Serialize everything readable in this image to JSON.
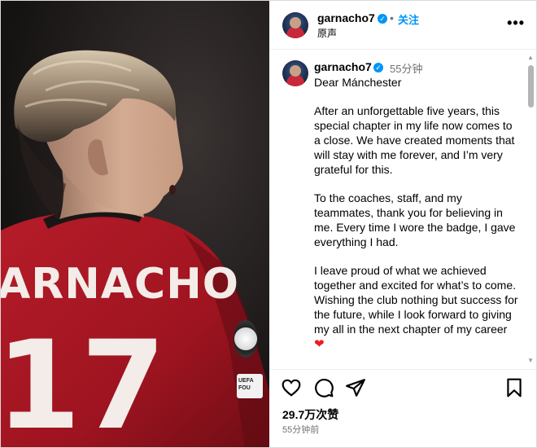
{
  "header": {
    "username": "garnacho7",
    "separator": "•",
    "follow_label": "关注",
    "audio_label": "原声",
    "more_label": "•••"
  },
  "caption": {
    "username": "garnacho7",
    "time": "55分钟",
    "paragraphs": [
      "Dear Mánchester",
      "After an unforgettable five years, this special chapter in my life now comes to a close. We have created moments that will stay with me forever, and I’m very grateful for this.",
      "To the coaches, staff, and my teammates, thank you for believing in me. Every time I wore the badge, I gave everything I had.",
      "I leave proud of what we achieved together and excited for what’s to come. Wishing the club nothing but success for the future, while I look forward to giving my all in the next chapter of my career"
    ],
    "heart_emoji": "❤"
  },
  "photo": {
    "shirt_name": "ARNACHO",
    "shirt_number": "17",
    "sleeve_patch": "UEFA FOU"
  },
  "footer": {
    "likes": "29.7万次赞",
    "post_time": "55分钟前"
  },
  "icons": {
    "verified": "verified-badge-icon",
    "like": "heart-icon",
    "comment": "comment-bubble-icon",
    "share": "paper-plane-icon",
    "save": "bookmark-icon"
  },
  "colors": {
    "accent": "#0095f6",
    "muted": "#737373",
    "jersey": "#c0202c",
    "heart": "#ed1c24"
  }
}
